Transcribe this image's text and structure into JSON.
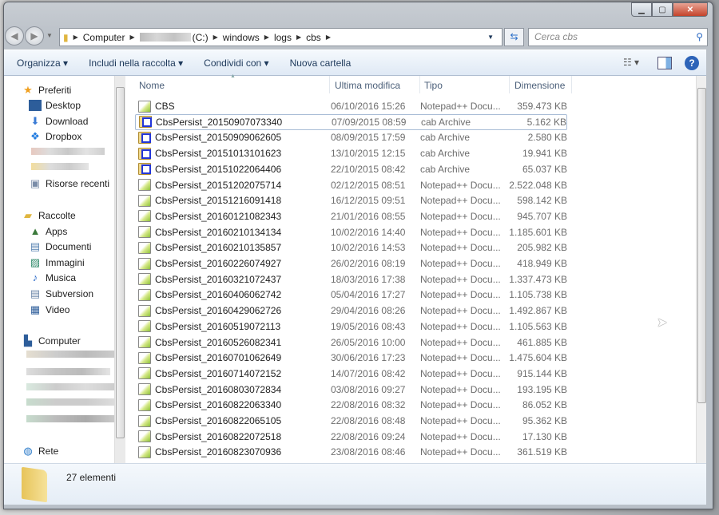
{
  "window": {
    "buttons": [
      "minimize",
      "maximize",
      "close"
    ]
  },
  "address": {
    "segments": [
      "Computer",
      "(C:)",
      "windows",
      "logs",
      "cbs"
    ]
  },
  "search": {
    "placeholder": "Cerca cbs"
  },
  "toolbar": {
    "organize": "Organizza ▾",
    "include": "Includi nella raccolta ▾",
    "share": "Condividi con ▾",
    "new_folder": "Nuova cartella"
  },
  "sidebar": {
    "favorites": {
      "label": "Preferiti",
      "items": [
        "Desktop",
        "Download",
        "Dropbox",
        "Risorse recenti"
      ]
    },
    "libraries": {
      "label": "Raccolte",
      "items": [
        "Apps",
        "Documenti",
        "Immagini",
        "Musica",
        "Subversion",
        "Video"
      ]
    },
    "computer": {
      "label": "Computer"
    },
    "network": {
      "label": "Rete"
    }
  },
  "columns": {
    "name": "Nome",
    "date": "Ultima modifica",
    "type": "Tipo",
    "size": "Dimensione"
  },
  "files": [
    {
      "name": "CBS",
      "date": "06/10/2016 15:26",
      "type": "Notepad++ Docu...",
      "size": "359.473 KB",
      "icon": "notepad"
    },
    {
      "name": "CbsPersist_20150907073340",
      "date": "07/09/2015 08:59",
      "type": "cab Archive",
      "size": "5.162 KB",
      "icon": "cab",
      "selected": true
    },
    {
      "name": "CbsPersist_20150909062605",
      "date": "08/09/2015 17:59",
      "type": "cab Archive",
      "size": "2.580 KB",
      "icon": "cab"
    },
    {
      "name": "CbsPersist_20151013101623",
      "date": "13/10/2015 12:15",
      "type": "cab Archive",
      "size": "19.941 KB",
      "icon": "cab"
    },
    {
      "name": "CbsPersist_20151022064406",
      "date": "22/10/2015 08:42",
      "type": "cab Archive",
      "size": "65.037 KB",
      "icon": "cab"
    },
    {
      "name": "CbsPersist_20151202075714",
      "date": "02/12/2015 08:51",
      "type": "Notepad++ Docu...",
      "size": "2.522.048 KB",
      "icon": "notepad"
    },
    {
      "name": "CbsPersist_20151216091418",
      "date": "16/12/2015 09:51",
      "type": "Notepad++ Docu...",
      "size": "598.142 KB",
      "icon": "notepad"
    },
    {
      "name": "CbsPersist_20160121082343",
      "date": "21/01/2016 08:55",
      "type": "Notepad++ Docu...",
      "size": "945.707 KB",
      "icon": "notepad"
    },
    {
      "name": "CbsPersist_20160210134134",
      "date": "10/02/2016 14:40",
      "type": "Notepad++ Docu...",
      "size": "1.185.601 KB",
      "icon": "notepad"
    },
    {
      "name": "CbsPersist_20160210135857",
      "date": "10/02/2016 14:53",
      "type": "Notepad++ Docu...",
      "size": "205.982 KB",
      "icon": "notepad"
    },
    {
      "name": "CbsPersist_20160226074927",
      "date": "26/02/2016 08:19",
      "type": "Notepad++ Docu...",
      "size": "418.949 KB",
      "icon": "notepad"
    },
    {
      "name": "CbsPersist_20160321072437",
      "date": "18/03/2016 17:38",
      "type": "Notepad++ Docu...",
      "size": "1.337.473 KB",
      "icon": "notepad"
    },
    {
      "name": "CbsPersist_20160406062742",
      "date": "05/04/2016 17:27",
      "type": "Notepad++ Docu...",
      "size": "1.105.738 KB",
      "icon": "notepad"
    },
    {
      "name": "CbsPersist_20160429062726",
      "date": "29/04/2016 08:26",
      "type": "Notepad++ Docu...",
      "size": "1.492.867 KB",
      "icon": "notepad"
    },
    {
      "name": "CbsPersist_20160519072113",
      "date": "19/05/2016 08:43",
      "type": "Notepad++ Docu...",
      "size": "1.105.563 KB",
      "icon": "notepad"
    },
    {
      "name": "CbsPersist_20160526082341",
      "date": "26/05/2016 10:00",
      "type": "Notepad++ Docu...",
      "size": "461.885 KB",
      "icon": "notepad"
    },
    {
      "name": "CbsPersist_20160701062649",
      "date": "30/06/2016 17:23",
      "type": "Notepad++ Docu...",
      "size": "1.475.604 KB",
      "icon": "notepad"
    },
    {
      "name": "CbsPersist_20160714072152",
      "date": "14/07/2016 08:42",
      "type": "Notepad++ Docu...",
      "size": "915.144 KB",
      "icon": "notepad"
    },
    {
      "name": "CbsPersist_20160803072834",
      "date": "03/08/2016 09:27",
      "type": "Notepad++ Docu...",
      "size": "193.195 KB",
      "icon": "notepad"
    },
    {
      "name": "CbsPersist_20160822063340",
      "date": "22/08/2016 08:32",
      "type": "Notepad++ Docu...",
      "size": "86.052 KB",
      "icon": "notepad"
    },
    {
      "name": "CbsPersist_20160822065105",
      "date": "22/08/2016 08:48",
      "type": "Notepad++ Docu...",
      "size": "95.362 KB",
      "icon": "notepad"
    },
    {
      "name": "CbsPersist_20160822072518",
      "date": "22/08/2016 09:24",
      "type": "Notepad++ Docu...",
      "size": "17.130 KB",
      "icon": "notepad"
    },
    {
      "name": "CbsPersist_20160823070936",
      "date": "23/08/2016 08:46",
      "type": "Notepad++ Docu...",
      "size": "361.519 KB",
      "icon": "notepad"
    }
  ],
  "status": {
    "count": "27 elementi"
  }
}
